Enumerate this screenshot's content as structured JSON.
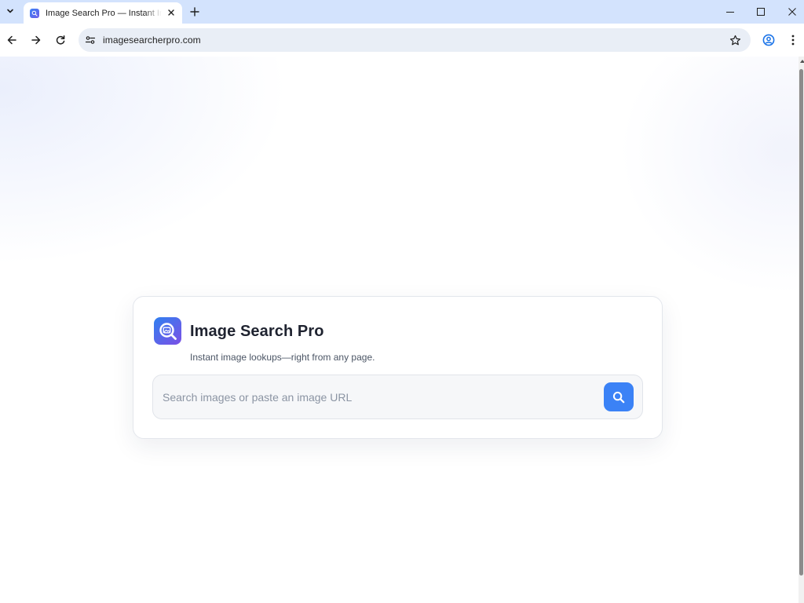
{
  "browser": {
    "tab_title": "Image Search Pro — Instant Image Lookups",
    "url": "imagesearcherpro.com",
    "icons": [
      "tab-search-menu-icon",
      "favicon-icon",
      "close-icon",
      "plus-icon",
      "minimize-icon",
      "maximize-icon",
      "window-close-icon",
      "back-arrow-icon",
      "forward-arrow-icon",
      "reload-icon",
      "site-info-icon",
      "star-icon",
      "profile-icon",
      "kebab-menu-icon"
    ]
  },
  "card": {
    "title": "Image Search Pro",
    "subtitle": "Instant image lookups—right from any page.",
    "search": {
      "value": "",
      "placeholder": "Search images or paste an image URL",
      "button_icon": "search-icon"
    }
  },
  "colors": {
    "tabbar": "#d3e3fd",
    "omnibox": "#e9eef6",
    "accent": "#3b82f6",
    "logo_gradient_start": "#2f80f0",
    "logo_gradient_end": "#7b4fe6"
  }
}
